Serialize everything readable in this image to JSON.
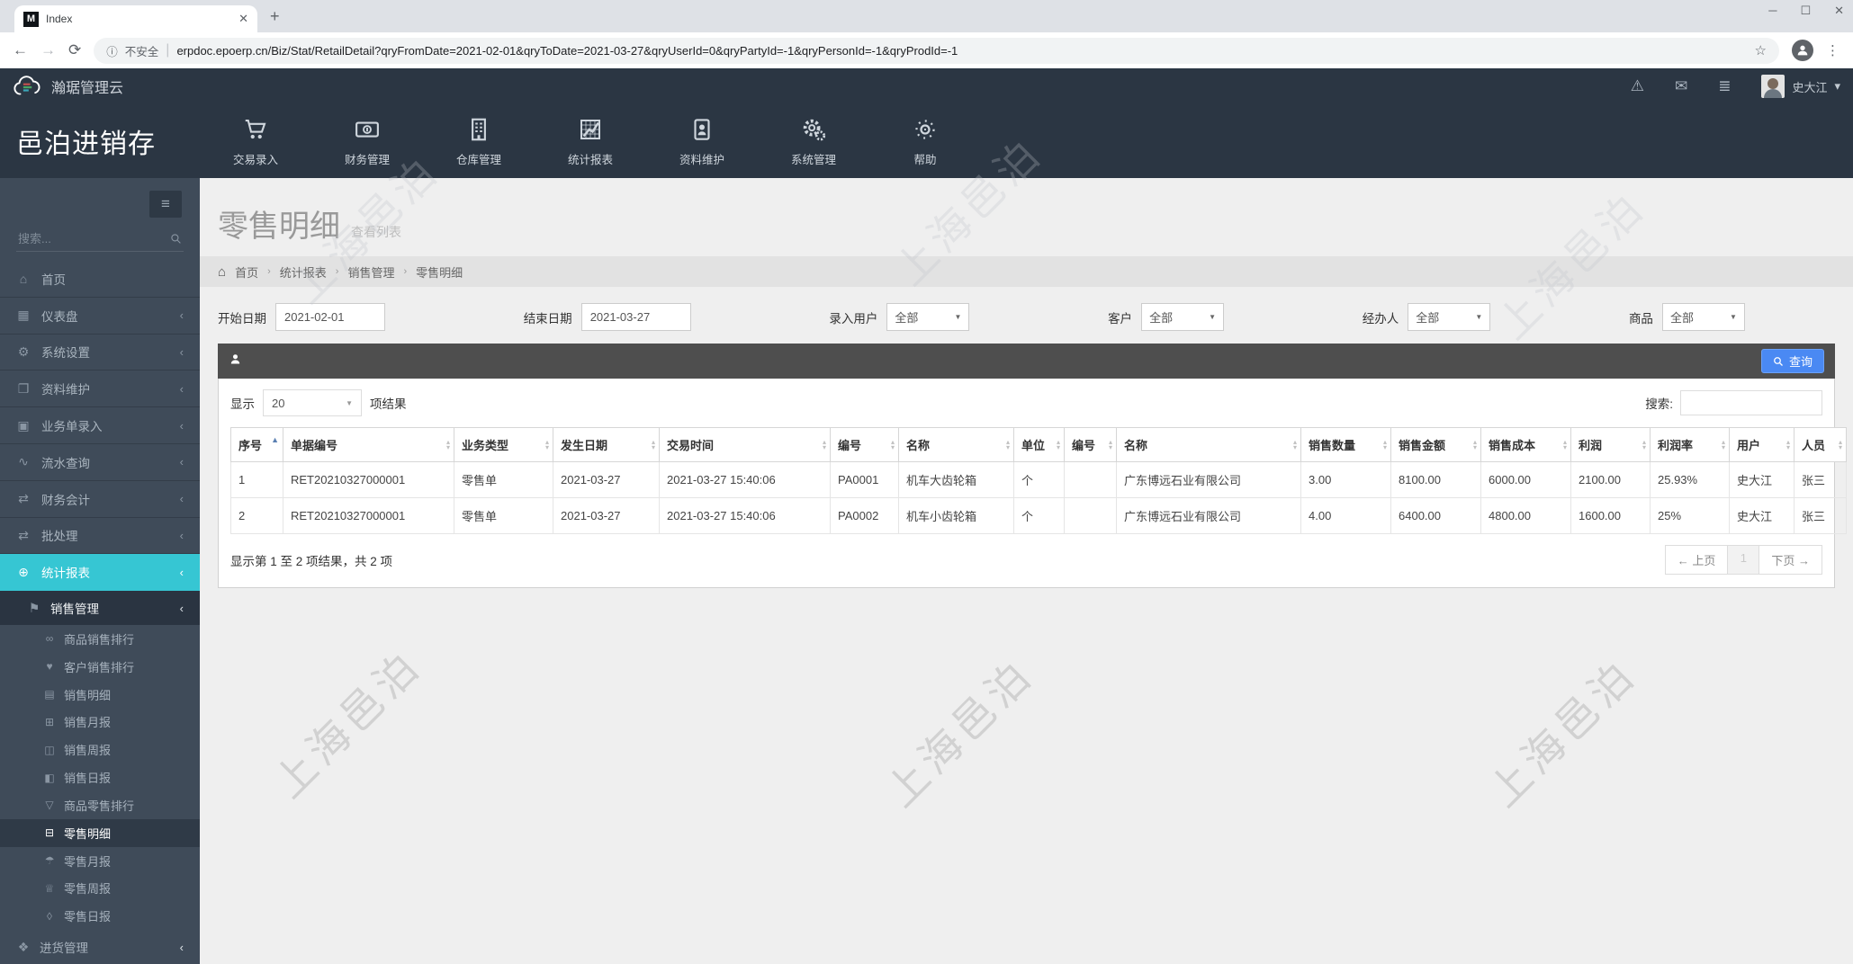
{
  "browser": {
    "favicon_letter": "M",
    "tab_title": "Index",
    "security_label": "不安全",
    "url": "erpdoc.epoerp.cn/Biz/Stat/RetailDetail?qryFromDate=2021-02-01&qryToDate=2021-03-27&qryUserId=0&qryPartyId=-1&qryPersonId=-1&qryProdId=-1"
  },
  "topbar": {
    "brand": "瀚琚管理云",
    "username": "史大江"
  },
  "app": {
    "title": "邑泊进销存"
  },
  "nav_menu": {
    "items": [
      {
        "label": "交易录入"
      },
      {
        "label": "财务管理"
      },
      {
        "label": "仓库管理"
      },
      {
        "label": "统计报表"
      },
      {
        "label": "资料维护"
      },
      {
        "label": "系统管理"
      },
      {
        "label": "帮助"
      }
    ]
  },
  "sidebar": {
    "search_placeholder": "搜索...",
    "items": [
      {
        "label": "首页"
      },
      {
        "label": "仪表盘"
      },
      {
        "label": "系统设置"
      },
      {
        "label": "资料维护"
      },
      {
        "label": "业务单录入"
      },
      {
        "label": "流水查询"
      },
      {
        "label": "财务会计"
      },
      {
        "label": "批处理"
      },
      {
        "label": "统计报表"
      }
    ],
    "sales_submenu": {
      "label": "销售管理",
      "items": [
        "商品销售排行",
        "客户销售排行",
        "销售明细",
        "销售月报",
        "销售周报",
        "销售日报",
        "商品零售排行",
        "零售明细",
        "零售月报",
        "零售周报",
        "零售日报"
      ]
    },
    "next_section": "进货管理"
  },
  "main": {
    "page_title": "零售明细",
    "page_subtitle": "查看列表",
    "breadcrumb": [
      "首页",
      "统计报表",
      "销售管理",
      "零售明细"
    ],
    "filters": [
      {
        "label": "开始日期",
        "value": "2021-02-01"
      },
      {
        "label": "结束日期",
        "value": "2021-03-27"
      },
      {
        "label": "录入用户",
        "value": "全部"
      },
      {
        "label": "客户",
        "value": "全部"
      },
      {
        "label": "经办人",
        "value": "全部"
      },
      {
        "label": "商品",
        "value": "全部"
      }
    ],
    "query_button": "查询",
    "table": {
      "show_label": "显示",
      "page_size": "20",
      "results_suffix": "项结果",
      "search_label": "搜索:",
      "columns": [
        "序号",
        "单据编号",
        "业务类型",
        "发生日期",
        "交易时间",
        "编号",
        "名称",
        "单位",
        "编号",
        "名称",
        "销售数量",
        "销售金额",
        "销售成本",
        "利润",
        "利润率",
        "用户",
        "人员"
      ],
      "rows": [
        [
          "1",
          "RET20210327000001",
          "零售单",
          "2021-03-27",
          "2021-03-27 15:40:06",
          "PA0001",
          "机车大齿轮箱",
          "个",
          "",
          "广东博远石业有限公司",
          "3.00",
          "8100.00",
          "6000.00",
          "2100.00",
          "25.93%",
          "史大江",
          "张三"
        ],
        [
          "2",
          "RET20210327000001",
          "零售单",
          "2021-03-27",
          "2021-03-27 15:40:06",
          "PA0002",
          "机车小齿轮箱",
          "个",
          "",
          "广东博远石业有限公司",
          "4.00",
          "6400.00",
          "4800.00",
          "1600.00",
          "25%",
          "史大江",
          "张三"
        ]
      ],
      "footer_text": "显示第 1 至 2 项结果，共 2 项",
      "prev_label": "← 上页",
      "current_page": "1",
      "next_label": "下页 →"
    },
    "watermark_text": "上海邑泊"
  }
}
